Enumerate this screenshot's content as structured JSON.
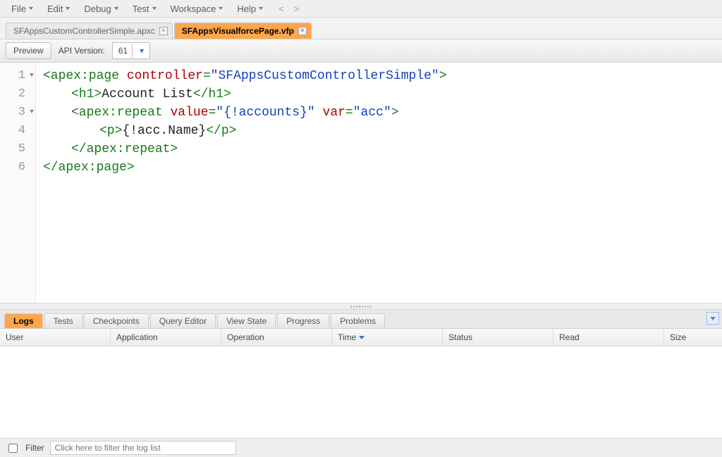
{
  "menubar": {
    "items": [
      "File",
      "Edit",
      "Debug",
      "Test",
      "Workspace",
      "Help"
    ],
    "nav_prev": "<",
    "nav_next": ">"
  },
  "file_tabs": [
    {
      "label": "SFAppsCustomControllerSimple.apxc",
      "active": false
    },
    {
      "label": "SFAppsVisualforcePage.vfp",
      "active": true
    }
  ],
  "toolbar": {
    "preview_label": "Preview",
    "api_version_label": "API Version:",
    "api_version_value": "61"
  },
  "code": {
    "lines": [
      {
        "n": "1",
        "foldable": true,
        "indent": 0,
        "segments": [
          {
            "cls": "tag",
            "t": "<apex:page "
          },
          {
            "cls": "attr",
            "t": "controller"
          },
          {
            "cls": "tag",
            "t": "="
          },
          {
            "cls": "str",
            "t": "\"SFAppsCustomControllerSimple\""
          },
          {
            "cls": "tag",
            "t": ">"
          }
        ]
      },
      {
        "n": "2",
        "foldable": false,
        "indent": 1,
        "segments": [
          {
            "cls": "tag",
            "t": "<h1>"
          },
          {
            "cls": "text",
            "t": "Account List"
          },
          {
            "cls": "tag",
            "t": "</h1>"
          }
        ]
      },
      {
        "n": "3",
        "foldable": true,
        "indent": 1,
        "segments": [
          {
            "cls": "tag",
            "t": "<apex:repeat "
          },
          {
            "cls": "attr",
            "t": "value"
          },
          {
            "cls": "tag",
            "t": "="
          },
          {
            "cls": "str",
            "t": "\"{!accounts}\""
          },
          {
            "cls": "tag",
            "t": " "
          },
          {
            "cls": "attr",
            "t": "var"
          },
          {
            "cls": "tag",
            "t": "="
          },
          {
            "cls": "str",
            "t": "\"acc\""
          },
          {
            "cls": "tag",
            "t": ">"
          }
        ]
      },
      {
        "n": "4",
        "foldable": false,
        "indent": 2,
        "segments": [
          {
            "cls": "tag",
            "t": "<p>"
          },
          {
            "cls": "text",
            "t": "{!acc.Name}"
          },
          {
            "cls": "tag",
            "t": "</p>"
          }
        ]
      },
      {
        "n": "5",
        "foldable": false,
        "indent": 1,
        "segments": [
          {
            "cls": "tag",
            "t": "</apex:repeat>"
          }
        ]
      },
      {
        "n": "6",
        "foldable": false,
        "indent": 0,
        "segments": [
          {
            "cls": "tag",
            "t": "</apex:page>"
          }
        ]
      }
    ]
  },
  "bottom_panel": {
    "tabs": [
      "Logs",
      "Tests",
      "Checkpoints",
      "Query Editor",
      "View State",
      "Progress",
      "Problems"
    ],
    "active_tab": "Logs",
    "columns": [
      {
        "key": "user",
        "label": "User"
      },
      {
        "key": "app",
        "label": "Application"
      },
      {
        "key": "op",
        "label": "Operation"
      },
      {
        "key": "time",
        "label": "Time",
        "sort": "desc"
      },
      {
        "key": "status",
        "label": "Status"
      },
      {
        "key": "read",
        "label": "Read"
      },
      {
        "key": "size",
        "label": "Size"
      }
    ],
    "filter_label": "Filter",
    "filter_placeholder": "Click here to filter the log list"
  }
}
